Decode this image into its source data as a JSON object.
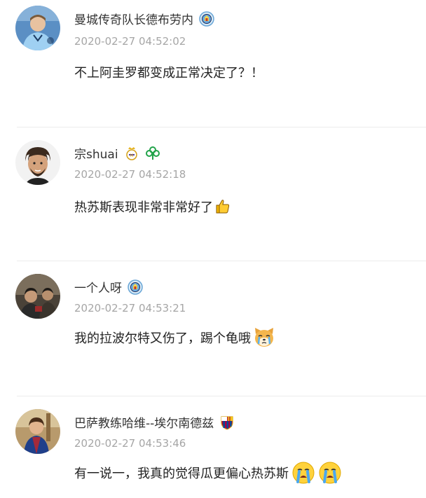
{
  "comments": [
    {
      "username": "曼城传奇队长德布劳内",
      "timestamp": "2020-02-27 04:52:02",
      "text": "不上阿圭罗都变成正常决定了？！",
      "badges": [
        "man-city-badge-icon"
      ]
    },
    {
      "username": "宗shuai",
      "timestamp": "2020-02-27 04:52:18",
      "text": "热苏斯表现非常非常好了",
      "badges": [
        "real-madrid-badge-icon",
        "green-clover-badge-icon"
      ],
      "emojis": [
        "thumbs-up-icon"
      ]
    },
    {
      "username": "一个人呀",
      "timestamp": "2020-02-27 04:53:21",
      "text": "我的拉波尔特又伤了，踢个龟哦",
      "badges": [
        "man-city-badge-icon"
      ],
      "emojis": [
        "crying-dog-icon"
      ]
    },
    {
      "username": "巴萨教练哈维--埃尔南德兹",
      "timestamp": "2020-02-27 04:53:46",
      "text": "有一说一，我真的觉得瓜更偏心热苏斯",
      "badges": [
        "barcelona-badge-icon"
      ],
      "emojis": [
        "crying-face-icon",
        "crying-face-icon"
      ]
    }
  ],
  "colors": {
    "username": "#333333",
    "timestamp": "#a6a6a6",
    "text": "#222222",
    "divider": "#ececec"
  }
}
